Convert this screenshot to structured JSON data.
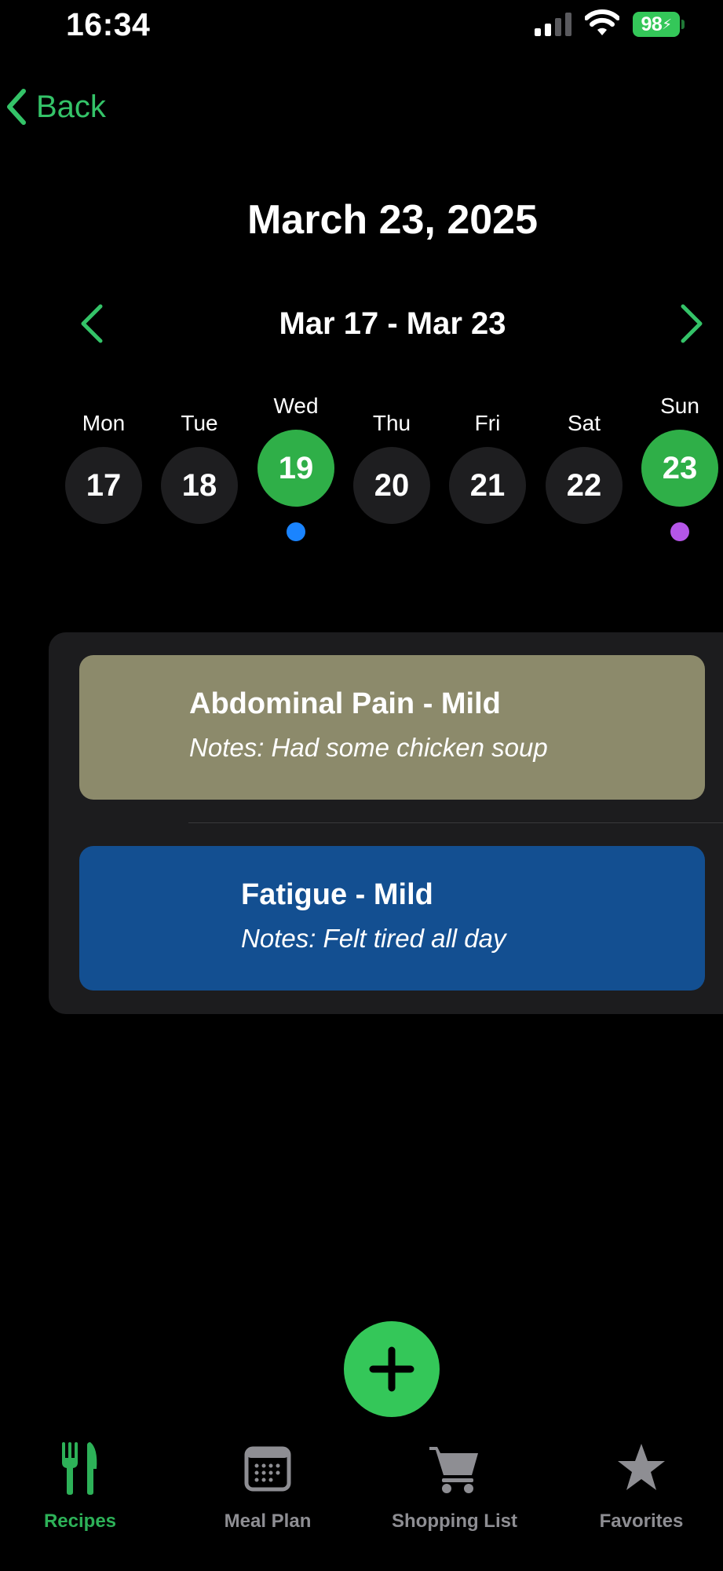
{
  "status_bar": {
    "time": "16:34",
    "battery": "98"
  },
  "nav": {
    "back_label": "Back"
  },
  "page_title": "March 23, 2025",
  "week": {
    "range": "Mar 17 - Mar 23",
    "days": [
      {
        "label": "Mon",
        "date": "17"
      },
      {
        "label": "Tue",
        "date": "18"
      },
      {
        "label": "Wed",
        "date": "19"
      },
      {
        "label": "Thu",
        "date": "20"
      },
      {
        "label": "Fri",
        "date": "21"
      },
      {
        "label": "Sat",
        "date": "22"
      },
      {
        "label": "Sun",
        "date": "23"
      }
    ],
    "highlighted_days": [
      "19",
      "23"
    ],
    "dot_colors": {
      "19": "#1a84ff",
      "23": "#b556e8"
    }
  },
  "entries": [
    {
      "title": "Abdominal Pain - Mild",
      "notes": "Notes: Had some chicken soup",
      "color": "#8c8a6b"
    },
    {
      "title": "Fatigue - Mild",
      "notes": "Notes: Felt tired all day",
      "color": "#134f91"
    }
  ],
  "tabs": [
    {
      "label": "Recipes",
      "icon": "fork-knife-icon",
      "active": true
    },
    {
      "label": "Meal Plan",
      "icon": "calendar-icon",
      "active": false
    },
    {
      "label": "Shopping List",
      "icon": "cart-icon",
      "active": false
    },
    {
      "label": "Favorites",
      "icon": "star-icon",
      "active": false
    }
  ],
  "colors": {
    "accent": "#34c759",
    "selected_day": "#2faf48",
    "tab_inactive": "#8e8e93"
  }
}
